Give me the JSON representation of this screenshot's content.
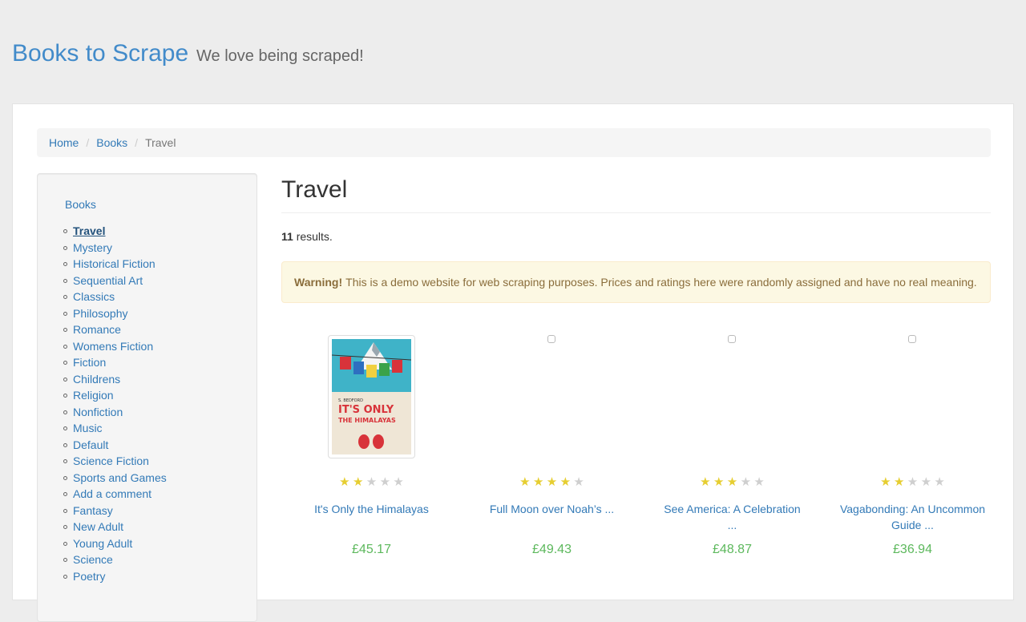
{
  "header": {
    "brand": "Books to Scrape",
    "tagline": "We love being scraped!"
  },
  "breadcrumb": [
    "Home",
    "Books",
    "Travel"
  ],
  "sidebar": {
    "root": "Books",
    "categories": [
      "Travel",
      "Mystery",
      "Historical Fiction",
      "Sequential Art",
      "Classics",
      "Philosophy",
      "Romance",
      "Womens Fiction",
      "Fiction",
      "Childrens",
      "Religion",
      "Nonfiction",
      "Music",
      "Default",
      "Science Fiction",
      "Sports and Games",
      "Add a comment",
      "Fantasy",
      "New Adult",
      "Young Adult",
      "Science",
      "Poetry"
    ],
    "current": "Travel"
  },
  "main": {
    "title": "Travel",
    "results_count": "11",
    "results_suffix": " results.",
    "warning_label": "Warning!",
    "warning_text": "This is a demo website for web scraping purposes. Prices and ratings here were randomly assigned and have no real meaning."
  },
  "products": [
    {
      "title": "It's Only the Himalayas",
      "price": "£45.17",
      "rating": 2,
      "cover": true
    },
    {
      "title": "Full Moon over Noah’s ...",
      "price": "£49.43",
      "rating": 4,
      "cover": false
    },
    {
      "title": "See America: A Celebration ...",
      "price": "£48.87",
      "rating": 3,
      "cover": false
    },
    {
      "title": "Vagabonding: An Uncommon Guide ...",
      "price": "£36.94",
      "rating": 2,
      "cover": false
    }
  ],
  "cover_art": {
    "author": "S. BEDFORD",
    "title_line1": "IT'S ONLY",
    "title_line2": "THE HIMALAYAS"
  },
  "colors": {
    "link": "#337ab7",
    "price": "#5cb85c",
    "star_on": "#e6ce31",
    "star_off": "#cfcfcf",
    "warning_bg": "#fcf8e3"
  }
}
